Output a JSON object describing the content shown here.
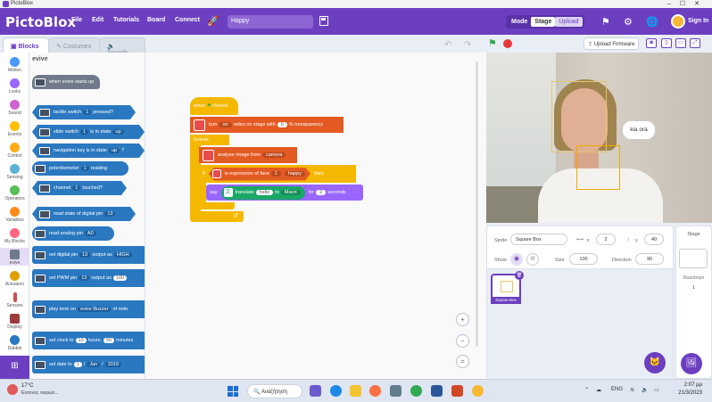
{
  "window": {
    "title": "PictoBlox"
  },
  "menubar": {
    "logo": "PictoBlox",
    "items": [
      "File",
      "Edit",
      "Tutorials",
      "Board",
      "Connect"
    ],
    "project_name": "Happy",
    "mode_label": "Mode",
    "mode_stage": "Stage",
    "mode_upload": "Upload",
    "sign_in": "Sign In"
  },
  "tabs": {
    "blocks": "Blocks",
    "costumes": "Costumes",
    "sounds": "Sounds"
  },
  "toolbar": {
    "upload_firmware": "Upload Firmware"
  },
  "categories": [
    {
      "label": "Motion",
      "color": "#4c97ff"
    },
    {
      "label": "Looks",
      "color": "#9966ff"
    },
    {
      "label": "Sound",
      "color": "#cf63cf"
    },
    {
      "label": "Events",
      "color": "#ffbf00"
    },
    {
      "label": "Control",
      "color": "#ffab19"
    },
    {
      "label": "Sensing",
      "color": "#5cb1d6"
    },
    {
      "label": "Operators",
      "color": "#59c059"
    },
    {
      "label": "Variables",
      "color": "#ff8c1a"
    },
    {
      "label": "My Blocks",
      "color": "#ff6680"
    },
    {
      "label": "evive",
      "color": "#707a8a"
    },
    {
      "label": "Actuators",
      "color": "#e2a000"
    },
    {
      "label": "Sensors",
      "color": "#d14c4c"
    },
    {
      "label": "Display",
      "color": "#9b3b3b"
    },
    {
      "label": "Dabble",
      "color": "#2a78c0"
    }
  ],
  "palette": {
    "title": "evive",
    "blocks": [
      {
        "parts": [
          "when evive starts up"
        ]
      },
      {
        "parts": [
          "tactile switch",
          "1",
          "pressed?"
        ]
      },
      {
        "parts": [
          "slide switch",
          "1",
          "is in state",
          "up"
        ]
      },
      {
        "parts": [
          "navigation key is in state",
          "up",
          "?"
        ]
      },
      {
        "parts": [
          "potentiometer",
          "1",
          "reading"
        ]
      },
      {
        "parts": [
          "channel",
          "1",
          "touched?"
        ]
      },
      {
        "parts": [
          "read state of digital pin",
          "13"
        ]
      },
      {
        "parts": [
          "read analog pin",
          "A0"
        ]
      },
      {
        "parts": [
          "set digital pin",
          "13",
          "output as",
          "HIGH"
        ]
      },
      {
        "parts": [
          "set PWM pin",
          "13",
          "output as",
          "100"
        ]
      },
      {
        "parts": [
          "play tone on",
          "evive Buzzer",
          "of note"
        ]
      },
      {
        "parts": [
          "set clock to",
          "10",
          "hours,",
          "50",
          "minutes"
        ]
      },
      {
        "parts": [
          "set date to",
          "1",
          "/",
          "Jan",
          "/",
          "2019"
        ]
      }
    ]
  },
  "script": {
    "hat": [
      "when",
      "clicked"
    ],
    "turn": [
      "turn",
      "on",
      "video on stage with",
      "0",
      "% transparency"
    ],
    "forever": "forever",
    "analyse": [
      "analyse image from",
      "camera"
    ],
    "if_parts": [
      "if",
      "is expression of face",
      "1",
      "happy",
      "then"
    ],
    "say": [
      "say",
      "translate",
      "hello",
      "to",
      "Maori",
      "for",
      "2",
      "seconds"
    ]
  },
  "stage": {
    "speech": "kia ora"
  },
  "sprite_info": {
    "sprite_label": "Sprite",
    "sprite_name": "Square Box",
    "x_label": "x",
    "x": "2",
    "y_label": "y",
    "y": "40",
    "show_label": "Show",
    "size_label": "Size",
    "size": "100",
    "direction_label": "Direction",
    "direction": "90",
    "thumb_label": "Square Box"
  },
  "stage_pane": {
    "title": "Stage",
    "backdrops_label": "Backdrops",
    "backdrops_count": "1"
  },
  "taskbar": {
    "temp": "17°C",
    "weather": "Εντονες νεφώσ...",
    "search": "Αναζήτηση",
    "lang": "ENG",
    "time": "2:07 μμ",
    "date": "21/3/2023"
  }
}
